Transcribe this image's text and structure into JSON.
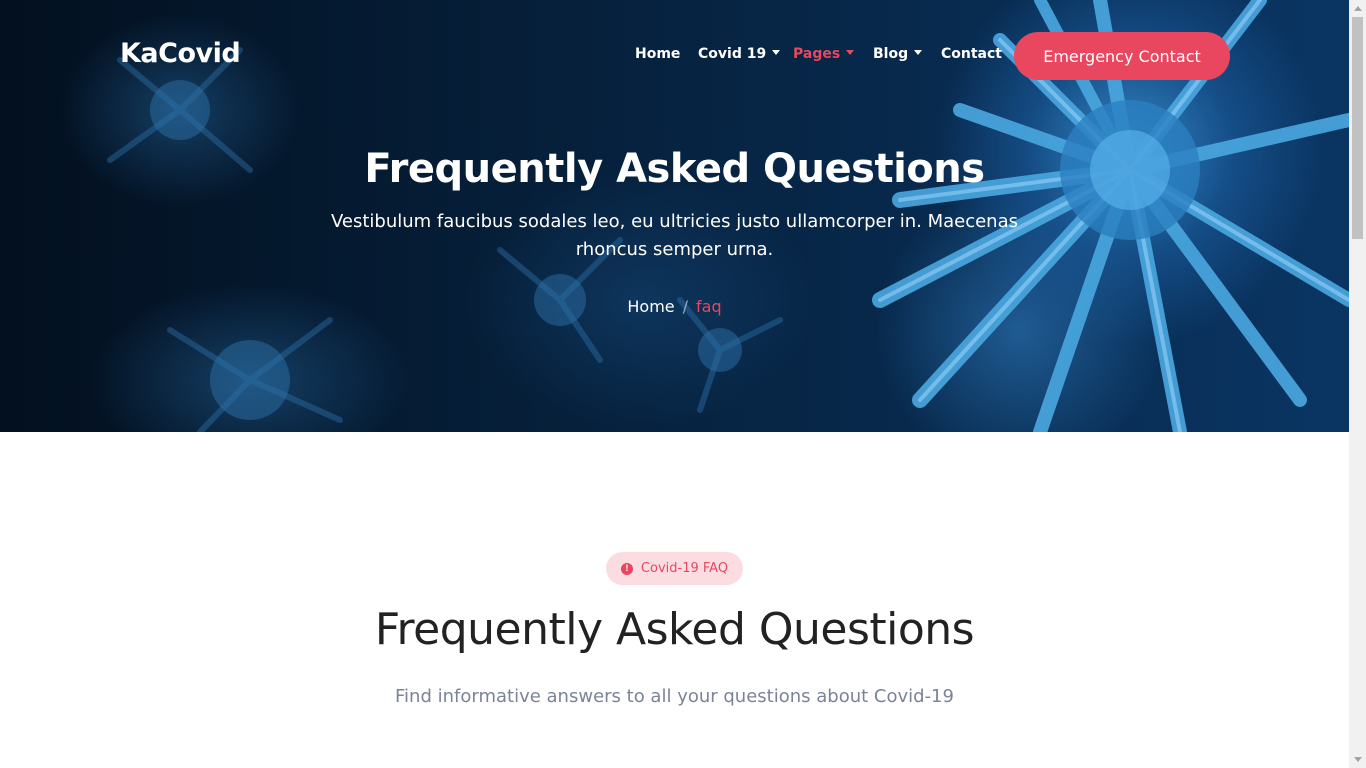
{
  "brand": {
    "name": "KaCovid"
  },
  "nav": {
    "items": [
      {
        "label": "Home",
        "has_caret": false,
        "active": false
      },
      {
        "label": "Covid 19",
        "has_caret": true,
        "active": false
      },
      {
        "label": "Pages",
        "has_caret": true,
        "active": true
      },
      {
        "label": "Blog",
        "has_caret": true,
        "active": false
      },
      {
        "label": "Contact",
        "has_caret": false,
        "active": false
      }
    ],
    "cta_label": "Emergency Contact"
  },
  "hero": {
    "title": "Frequently Asked Questions",
    "subtitle": "Vestibulum faucibus sodales leo, eu ultricies justo ullamcorper in. Maecenas rhoncus semper urna."
  },
  "breadcrumb": {
    "home": "Home",
    "separator": "/",
    "current": "faq"
  },
  "faq_section": {
    "badge_label": "Covid-19 FAQ",
    "badge_icon": "info-icon",
    "title": "Frequently Asked Questions",
    "subtitle": "Find informative answers to all your questions about Covid-19"
  },
  "colors": {
    "accent": "#e8475f",
    "badge_bg": "#fbdde1",
    "heading": "#222222",
    "muted": "#7a8399"
  }
}
